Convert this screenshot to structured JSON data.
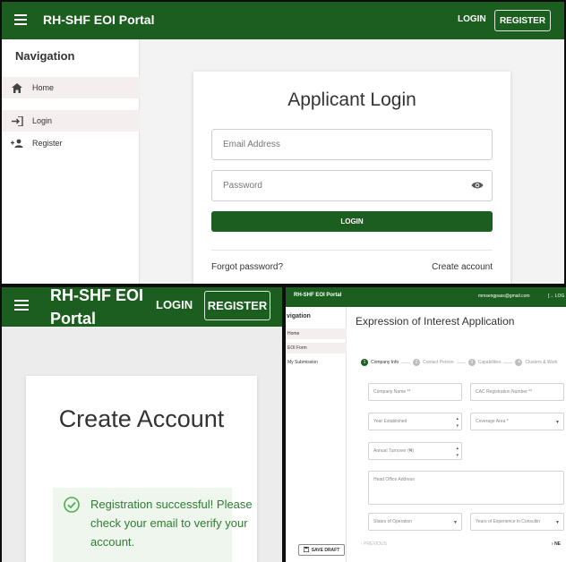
{
  "login_screen": {
    "app_title": "RH-SHF EOI Portal",
    "header_login": "LOGIN",
    "header_register": "REGISTER",
    "nav_heading": "Navigation",
    "nav_items": [
      {
        "label": "Home",
        "icon": "home-icon"
      },
      {
        "label": "Login",
        "icon": "login-icon"
      },
      {
        "label": "Register",
        "icon": "person-add-icon"
      }
    ],
    "card_title": "Applicant Login",
    "email_placeholder": "Email Address",
    "password_placeholder": "Password",
    "login_button": "LOGIN",
    "forgot_password": "Forgot password?",
    "create_account": "Create account"
  },
  "register_screen": {
    "app_title": "RH-SHF EOI Portal",
    "header_login": "LOGIN",
    "header_register": "REGISTER",
    "card_title": "Create Account",
    "success_message": "Registration successful! Please check your email to verify your account."
  },
  "eoi_screen": {
    "app_title": "RH-SHF EOI Portal",
    "user_email": "mmsengpass@gmail.com",
    "logout": "LOG",
    "nav_heading": "vigation",
    "nav_items": [
      "Home",
      "EOI Form",
      "My Submission"
    ],
    "page_title": "Expression of Interest Application",
    "steps": [
      {
        "num": "1",
        "label": "Company Info"
      },
      {
        "num": "2",
        "label": "Contact Person"
      },
      {
        "num": "3",
        "label": "Capabilities"
      },
      {
        "num": "4",
        "label": "Clusters & Work"
      }
    ],
    "fields": {
      "company_name": "Company Name **",
      "cac_number": "CAC Registration Number **",
      "year_established": "Year Established",
      "coverage_area": "Coverage Area *",
      "annual_turnover": "Annual Turnover (₦)",
      "head_office": "Head Office Address",
      "states": "States of Operation",
      "experience": "Years of Experience in Consultin"
    },
    "previous": "PREVIOUS",
    "next": "NE",
    "save_draft": "SAVE DRAFT"
  },
  "colors": {
    "primary": "#1b5e20",
    "success": "#2e7d32"
  }
}
